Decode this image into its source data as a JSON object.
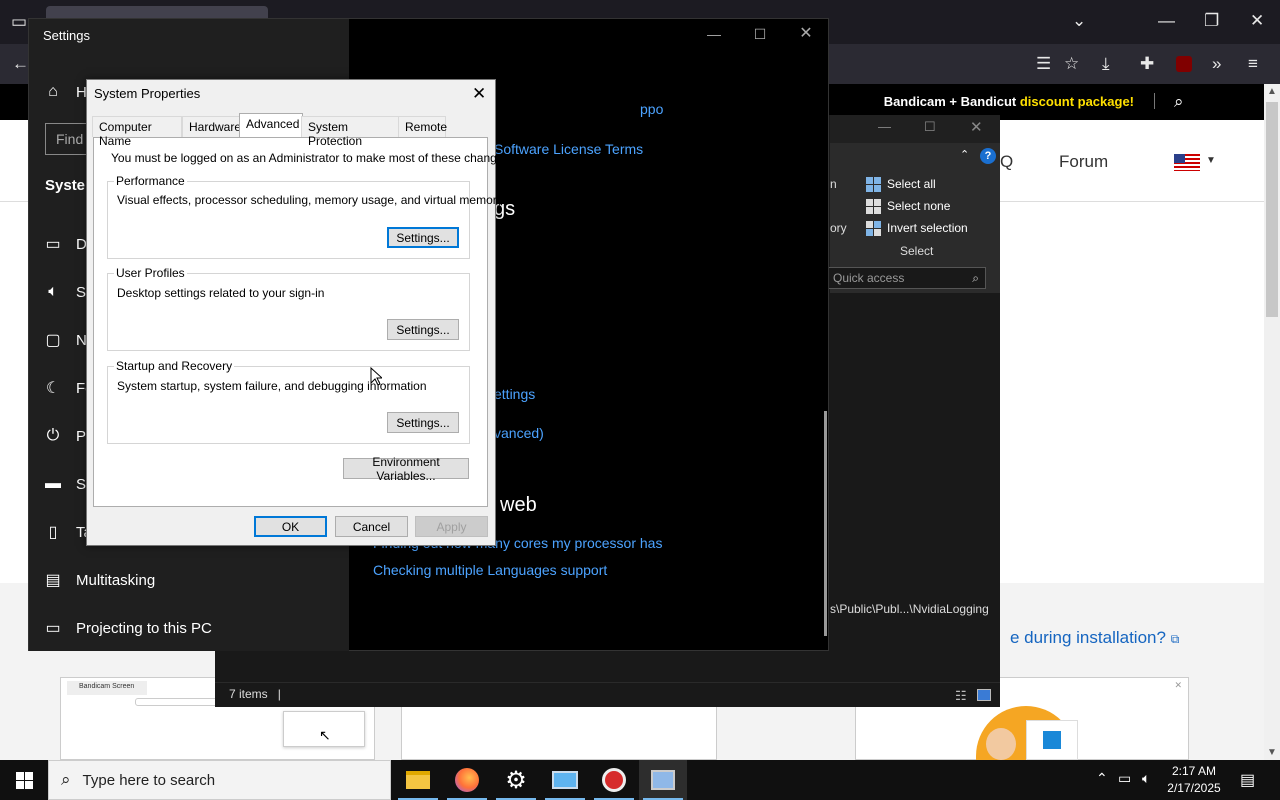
{
  "browser": {
    "promo_text": "Bandicam + Bandicut ",
    "promo_highlight": "discount package!",
    "nav_faq": "Q",
    "nav_forum": "Forum",
    "bottom_link": "e during installation?",
    "thumb1_tab": "Bandicam Screen"
  },
  "settings": {
    "title": "Settings",
    "find_placeholder": "Find",
    "section": "System",
    "nav": [
      "H",
      "D",
      "So",
      "N",
      "Fo",
      "Po",
      "St",
      "Ta",
      "Multitasking",
      "Projecting to this PC"
    ],
    "link_top_fragment": "ppo",
    "link_license": "Software License Terms",
    "heading_fragment": "gs",
    "link_settings": "ettings",
    "link_advanced": "vanced)",
    "heading_web": "web",
    "link_cores": "Finding out how many cores my processor has",
    "link_languages": "Checking multiple Languages support"
  },
  "explorer": {
    "ribbon_partial1": "n",
    "ribbon_partial2": "ory",
    "select_all": "Select all",
    "select_none": "Select none",
    "invert_selection": "Invert selection",
    "select_group": "Select",
    "search_placeholder": "Quick access",
    "path": "s\\Public\\Publ...\\NvidiaLogging",
    "status": "7 items"
  },
  "sysprop": {
    "title": "System Properties",
    "tabs": [
      "Computer Name",
      "Hardware",
      "Advanced",
      "System Protection",
      "Remote"
    ],
    "active_tab": "Advanced",
    "admin_note": "You must be logged on as an Administrator to make most of these changes.",
    "performance_label": "Performance",
    "performance_desc": "Visual effects, processor scheduling, memory usage, and virtual memory",
    "profiles_label": "User Profiles",
    "profiles_desc": "Desktop settings related to your sign-in",
    "startup_label": "Startup and Recovery",
    "startup_desc": "System startup, system failure, and debugging information",
    "settings_btn": "Settings...",
    "env_btn": "Environment Variables...",
    "ok": "OK",
    "cancel": "Cancel",
    "apply": "Apply"
  },
  "taskbar": {
    "search_placeholder": "Type here to search",
    "time": "2:17 AM",
    "date": "2/17/2025",
    "apps": [
      "file-explorer",
      "firefox",
      "settings",
      "remote-desktop",
      "bandicam",
      "system-app"
    ]
  }
}
